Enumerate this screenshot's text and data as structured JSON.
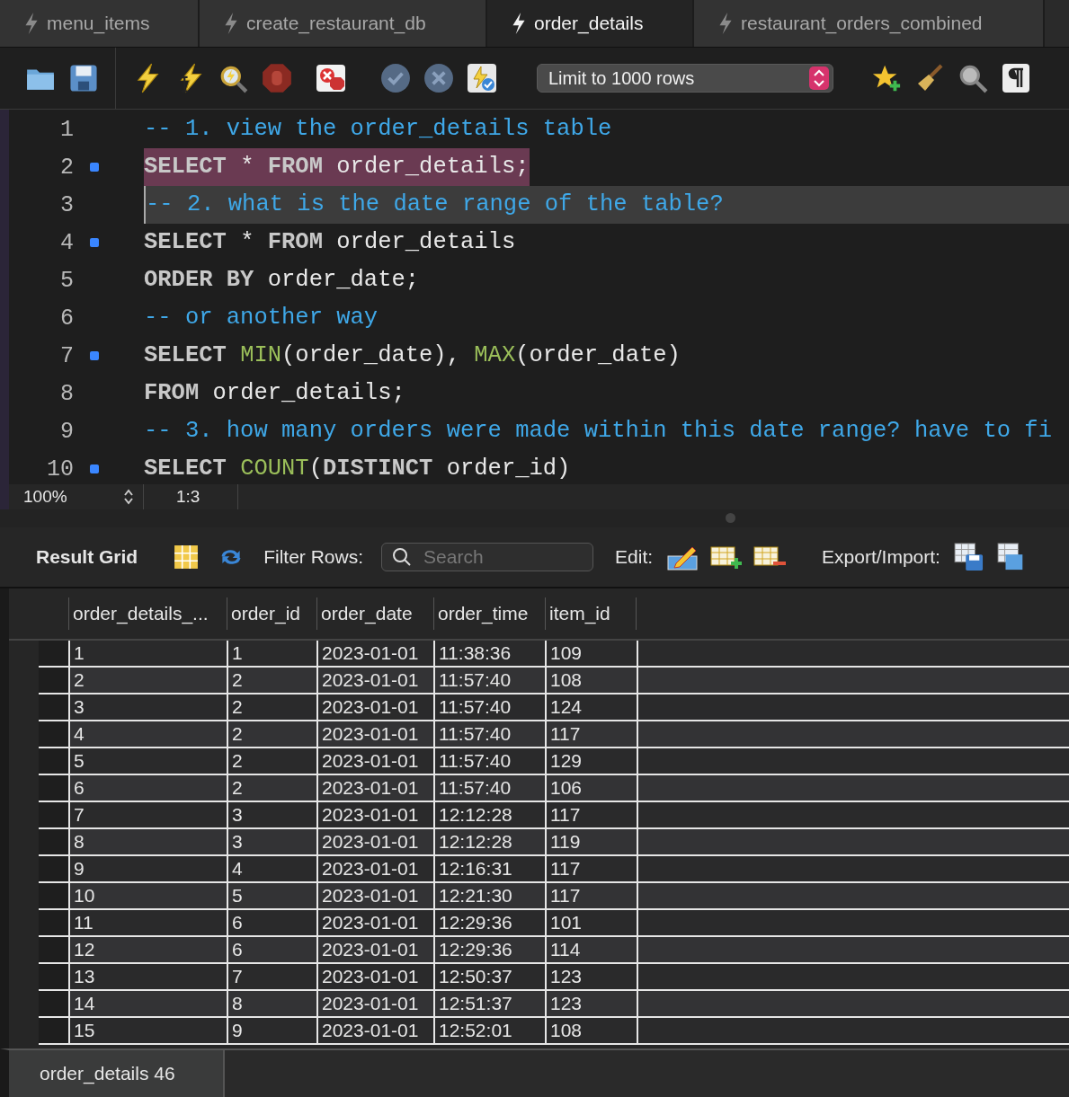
{
  "tabs": [
    {
      "label": "menu_items",
      "selected": false
    },
    {
      "label": "create_restaurant_db",
      "selected": false
    },
    {
      "label": "order_details",
      "selected": true
    },
    {
      "label": "restaurant_orders_combined",
      "selected": false
    }
  ],
  "toolbar": {
    "limit_select": "Limit to 1000 rows"
  },
  "editor": {
    "lines": [
      {
        "number": "1",
        "marker": false,
        "selected": false,
        "current": false,
        "tokens": [
          {
            "kind": "comment",
            "text": "-- 1. view the order_details table"
          }
        ]
      },
      {
        "number": "2",
        "marker": true,
        "selected": true,
        "current": false,
        "tokens": [
          {
            "kind": "keyword",
            "text": "SELECT"
          },
          {
            "kind": "plain",
            "text": " * "
          },
          {
            "kind": "keyword",
            "text": "FROM"
          },
          {
            "kind": "plain",
            "text": " order_details;"
          }
        ]
      },
      {
        "number": "3",
        "marker": false,
        "selected": false,
        "current": true,
        "tokens": [
          {
            "kind": "comment",
            "text": "-- 2. what is the date range of the table?"
          }
        ]
      },
      {
        "number": "4",
        "marker": true,
        "selected": false,
        "current": false,
        "tokens": [
          {
            "kind": "keyword",
            "text": "SELECT"
          },
          {
            "kind": "plain",
            "text": " * "
          },
          {
            "kind": "keyword",
            "text": "FROM"
          },
          {
            "kind": "plain",
            "text": " order_details"
          }
        ]
      },
      {
        "number": "5",
        "marker": false,
        "selected": false,
        "current": false,
        "tokens": [
          {
            "kind": "keyword",
            "text": "ORDER BY"
          },
          {
            "kind": "plain",
            "text": " order_date;"
          }
        ]
      },
      {
        "number": "6",
        "marker": false,
        "selected": false,
        "current": false,
        "tokens": [
          {
            "kind": "comment",
            "text": "-- or another way"
          }
        ]
      },
      {
        "number": "7",
        "marker": true,
        "selected": false,
        "current": false,
        "tokens": [
          {
            "kind": "keyword",
            "text": "SELECT "
          },
          {
            "kind": "function",
            "text": "MIN"
          },
          {
            "kind": "plain",
            "text": "(order_date), "
          },
          {
            "kind": "function",
            "text": "MAX"
          },
          {
            "kind": "plain",
            "text": "(order_date)"
          }
        ]
      },
      {
        "number": "8",
        "marker": false,
        "selected": false,
        "current": false,
        "tokens": [
          {
            "kind": "keyword",
            "text": "FROM"
          },
          {
            "kind": "plain",
            "text": " order_details;"
          }
        ]
      },
      {
        "number": "9",
        "marker": false,
        "selected": false,
        "current": false,
        "tokens": [
          {
            "kind": "comment",
            "text": "-- 3. how many orders were made within this date range? have to fi"
          }
        ]
      },
      {
        "number": "10",
        "marker": true,
        "selected": false,
        "current": false,
        "tokens": [
          {
            "kind": "keyword",
            "text": "SELECT "
          },
          {
            "kind": "function",
            "text": "COUNT"
          },
          {
            "kind": "plain",
            "text": "("
          },
          {
            "kind": "keyword",
            "text": "DISTINCT"
          },
          {
            "kind": "plain",
            "text": " order_id)"
          }
        ]
      }
    ]
  },
  "editor_status": {
    "zoom": "100%",
    "position": "1:3"
  },
  "result_toolbar": {
    "title": "Result Grid",
    "filter_label": "Filter Rows:",
    "search_placeholder": "Search",
    "edit_label": "Edit:",
    "export_label": "Export/Import:"
  },
  "table": {
    "columns": [
      "order_details_...",
      "order_id",
      "order_date",
      "order_time",
      "item_id"
    ],
    "rows": [
      [
        "1",
        "1",
        "2023-01-01",
        "11:38:36",
        "109"
      ],
      [
        "2",
        "2",
        "2023-01-01",
        "11:57:40",
        "108"
      ],
      [
        "3",
        "2",
        "2023-01-01",
        "11:57:40",
        "124"
      ],
      [
        "4",
        "2",
        "2023-01-01",
        "11:57:40",
        "117"
      ],
      [
        "5",
        "2",
        "2023-01-01",
        "11:57:40",
        "129"
      ],
      [
        "6",
        "2",
        "2023-01-01",
        "11:57:40",
        "106"
      ],
      [
        "7",
        "3",
        "2023-01-01",
        "12:12:28",
        "117"
      ],
      [
        "8",
        "3",
        "2023-01-01",
        "12:12:28",
        "119"
      ],
      [
        "9",
        "4",
        "2023-01-01",
        "12:16:31",
        "117"
      ],
      [
        "10",
        "5",
        "2023-01-01",
        "12:21:30",
        "117"
      ],
      [
        "11",
        "6",
        "2023-01-01",
        "12:29:36",
        "101"
      ],
      [
        "12",
        "6",
        "2023-01-01",
        "12:29:36",
        "114"
      ],
      [
        "13",
        "7",
        "2023-01-01",
        "12:50:37",
        "123"
      ],
      [
        "14",
        "8",
        "2023-01-01",
        "12:51:37",
        "123"
      ],
      [
        "15",
        "9",
        "2023-01-01",
        "12:52:01",
        "108"
      ]
    ]
  },
  "result_tabs": [
    {
      "label": "order_details 46",
      "selected": true
    }
  ]
}
